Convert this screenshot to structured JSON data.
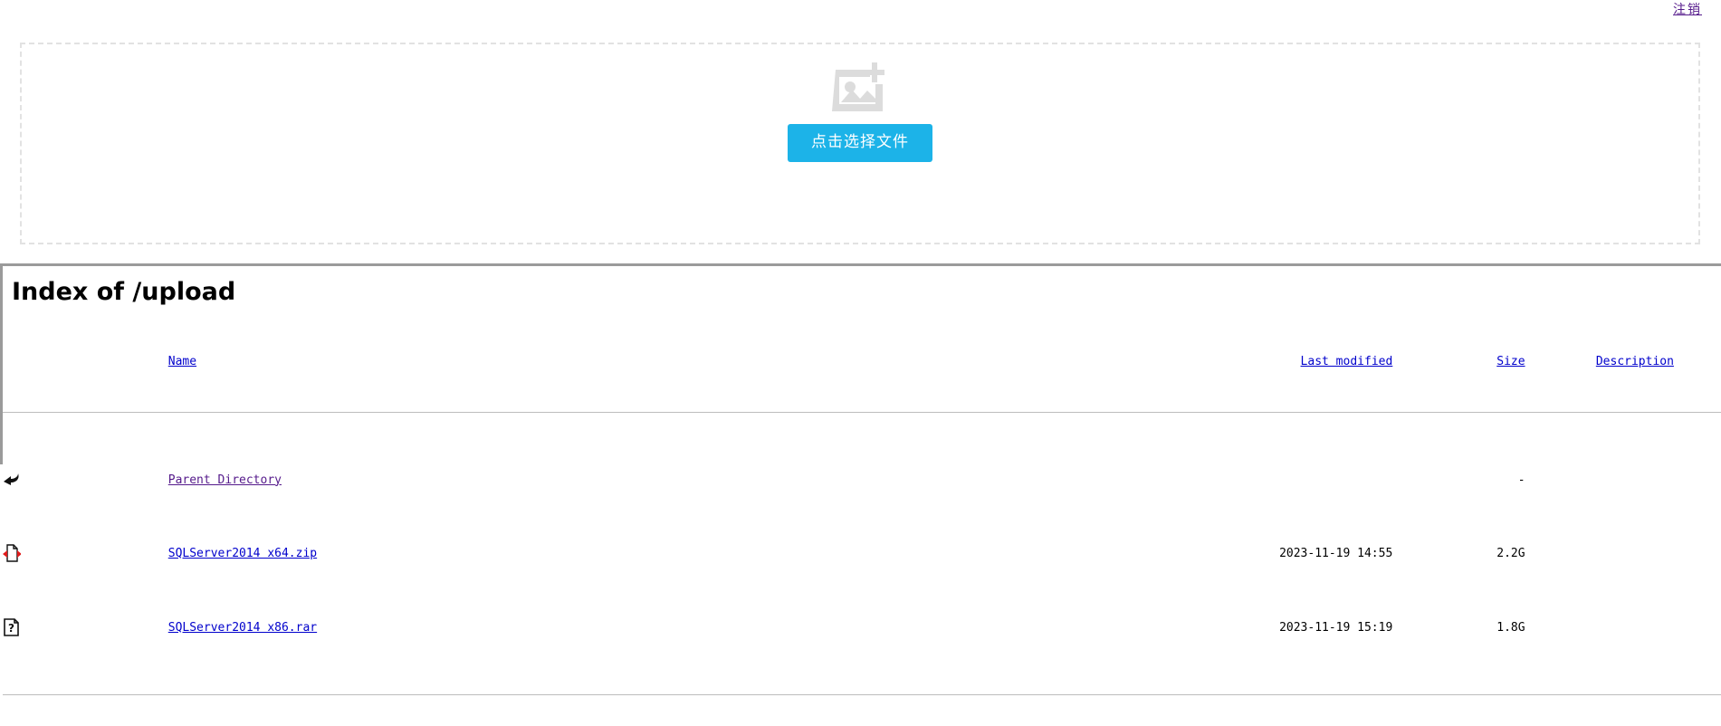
{
  "topbar": {
    "logout_label": "注销"
  },
  "uploader": {
    "icon": "image-plus-icon",
    "button_label": "点击选择文件",
    "accent_color": "#1cb3e8",
    "border_color": "#e2e2e2"
  },
  "index": {
    "title": "Index of /upload",
    "columns": [
      {
        "key": "name",
        "label": "Name"
      },
      {
        "key": "last_modified",
        "label": "Last modified"
      },
      {
        "key": "size",
        "label": "Size"
      },
      {
        "key": "description",
        "label": "Description"
      }
    ],
    "rows": [
      {
        "icon": "back-arrow-icon",
        "name": "Parent Directory",
        "last_modified": "",
        "size": "-",
        "description": "",
        "visited": true
      },
      {
        "icon": "compressed-file-icon",
        "name": "SQLServer2014 x64.zip",
        "last_modified": "2023-11-19 14:55",
        "size": "2.2G",
        "description": "",
        "visited": false
      },
      {
        "icon": "unknown-file-icon",
        "name": "SQLServer2014 x86.rar",
        "last_modified": "2023-11-19 15:19",
        "size": "1.8G",
        "description": "",
        "visited": false
      }
    ]
  },
  "colors": {
    "link": "#0000cc",
    "visited_link": "#551a8b",
    "rule": "#bdbdbd",
    "frame": "#9a9a9a"
  }
}
